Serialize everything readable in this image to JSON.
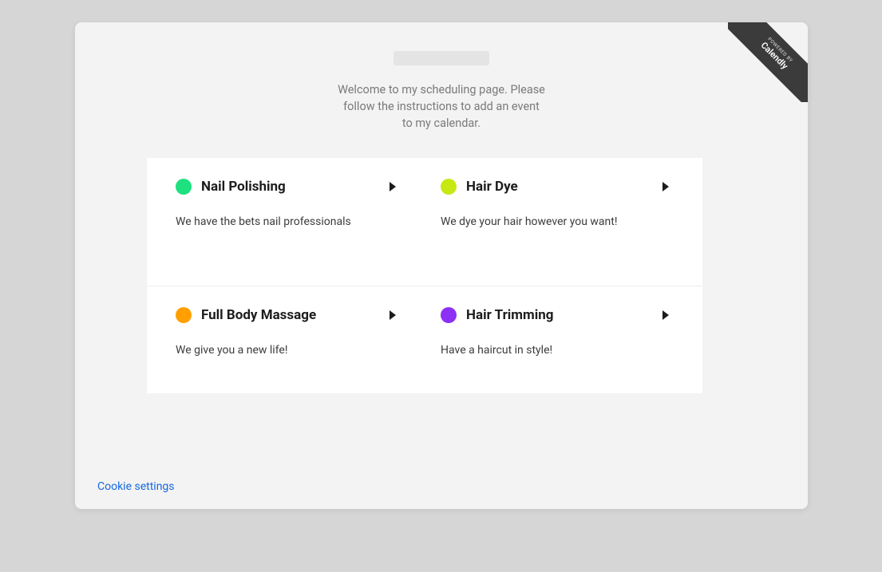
{
  "header": {
    "welcome_text": "Welcome to my scheduling page. Please follow the instructions to add an event to my calendar."
  },
  "ribbon": {
    "powered_by": "POWERED BY",
    "brand": "Calendly"
  },
  "events": [
    {
      "title": "Nail Polishing",
      "description": "We have the bets nail professionals",
      "color": "#1ee07f"
    },
    {
      "title": "Hair Dye",
      "description": "We dye your hair however you want!",
      "color": "#c8e812"
    },
    {
      "title": "Full Body Massage",
      "description": "We give you a new life!",
      "color": "#ffa000"
    },
    {
      "title": "Hair Trimming",
      "description": "Have a haircut in style!",
      "color": "#8c30f5"
    }
  ],
  "footer": {
    "cookie_settings": "Cookie settings"
  }
}
